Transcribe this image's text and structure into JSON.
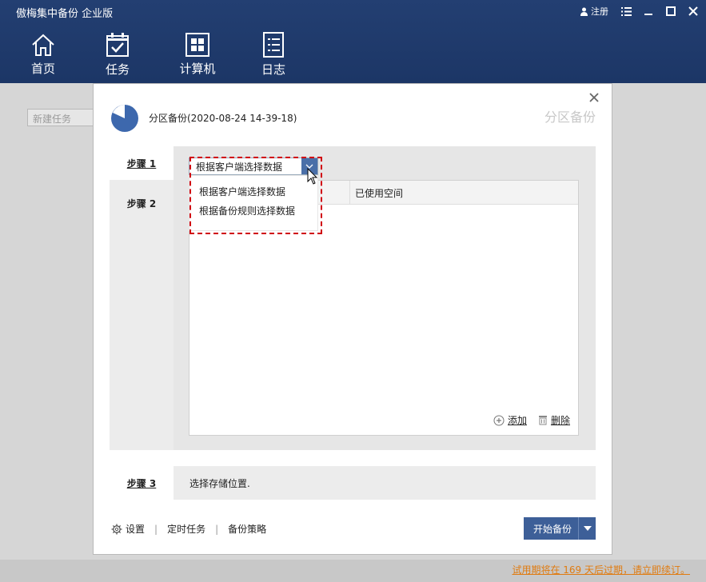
{
  "app": {
    "title": "傲梅集中备份 企业版",
    "register_label": "注册"
  },
  "nav": [
    {
      "label": "首页",
      "icon": "home-icon"
    },
    {
      "label": "任务",
      "icon": "task-icon"
    },
    {
      "label": "计算机",
      "icon": "windows-icon"
    },
    {
      "label": "日志",
      "icon": "log-icon"
    }
  ],
  "background": {
    "new_task_placeholder": "新建任务"
  },
  "dialog": {
    "name": "分区备份(2020-08-24 14-39-18)",
    "type_label": "分区备份",
    "steps": {
      "step1": "步骤 1",
      "step2": "步骤 2",
      "step3": "步骤 3"
    },
    "select": {
      "selected": "根据客户端选择数据",
      "options": [
        "根据客户端选择数据",
        "根据备份规则选择数据"
      ]
    },
    "table": {
      "col_used_space": "已使用空间"
    },
    "actions": {
      "add": "添加",
      "delete": "删除"
    },
    "step3_desc": "选择存储位置.",
    "footer": {
      "settings": "设置",
      "schedule": "定时任务",
      "strategy": "备份策略"
    },
    "start_button": "开始备份"
  },
  "trial_notice": "试用期将在 169 天后过期，请立即续订。",
  "colors": {
    "topbar": "#1f3a6b",
    "accent": "#3d5f98",
    "highlight": "#d0000e",
    "trial": "#e07b10"
  }
}
